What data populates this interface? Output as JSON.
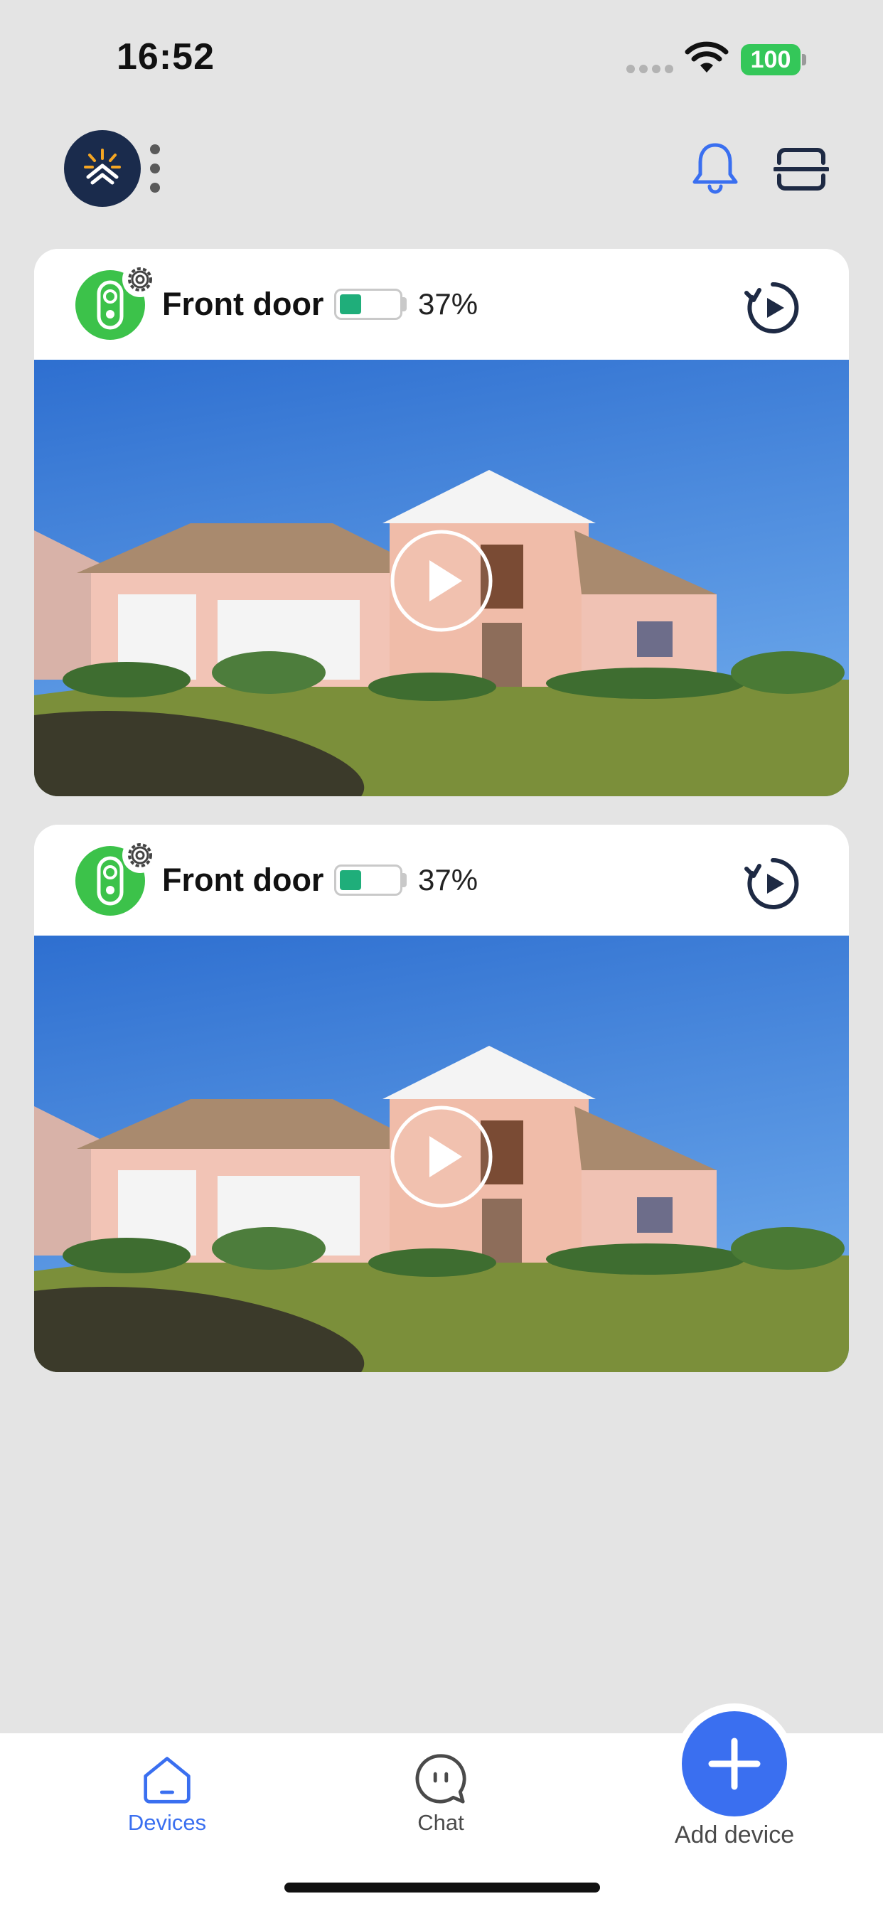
{
  "status_bar": {
    "time": "16:52",
    "battery_level": "100"
  },
  "header": {
    "logo_icon": "house-sun-logo-icon",
    "menu_icon": "vertical-dots-icon",
    "notifications_icon": "bell-icon",
    "scan_icon": "scan-icon"
  },
  "devices": [
    {
      "name": "Front door",
      "battery_percent": "37%",
      "battery_level": 0.37
    },
    {
      "name": "Front door",
      "battery_percent": "37%",
      "battery_level": 0.37
    }
  ],
  "tab_bar": {
    "devices_label": "Devices",
    "chat_label": "Chat",
    "add_device_label": "Add device"
  },
  "colors": {
    "accent": "#3a6ff0",
    "device_green": "#3cc24a",
    "battery_fill": "#1fae7a",
    "status_battery": "#34c759",
    "logo_navy": "#1a2b4c"
  }
}
